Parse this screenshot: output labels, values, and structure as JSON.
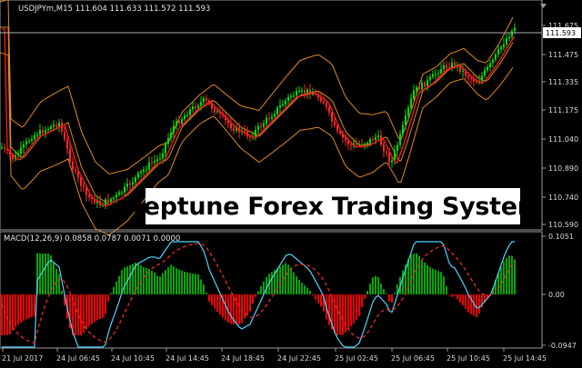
{
  "price_panel": {
    "title": "USDJPYm,M15  111.604 111.633 111.572 111.593",
    "current_price": "111.593",
    "price_ticks": [
      "111.675",
      "111.475",
      "111.335",
      "111.175",
      "111.040",
      "110.890",
      "110.740",
      "110.590"
    ],
    "colors": {
      "bull": "#00e000",
      "bear": "#ff2a2a",
      "ema": "#ff1a1a",
      "bands": "#e08a1e"
    }
  },
  "macd_panel": {
    "title": "MACD(12,26,9) 0.0858 0.0787 0.0071 0.0000",
    "ticks": [
      "0.1051",
      "0.00",
      "-0.0947"
    ],
    "colors": {
      "main": "#4fd3ff",
      "signal": "#ff2a2a",
      "hist_pos": "#00a800",
      "hist_neg": "#ff0000"
    }
  },
  "time_axis": [
    "21 Jul 2017",
    "24 Jul 06:45",
    "24 Jul 10:45",
    "24 Jul 14:45",
    "24 Jul 18:45",
    "24 Jul 22:45",
    "25 Jul 02:45",
    "25 Jul 06:45",
    "25 Jul 10:45",
    "25 Jul 14:45"
  ],
  "banner_text": "Neptune Forex Trading System"
}
